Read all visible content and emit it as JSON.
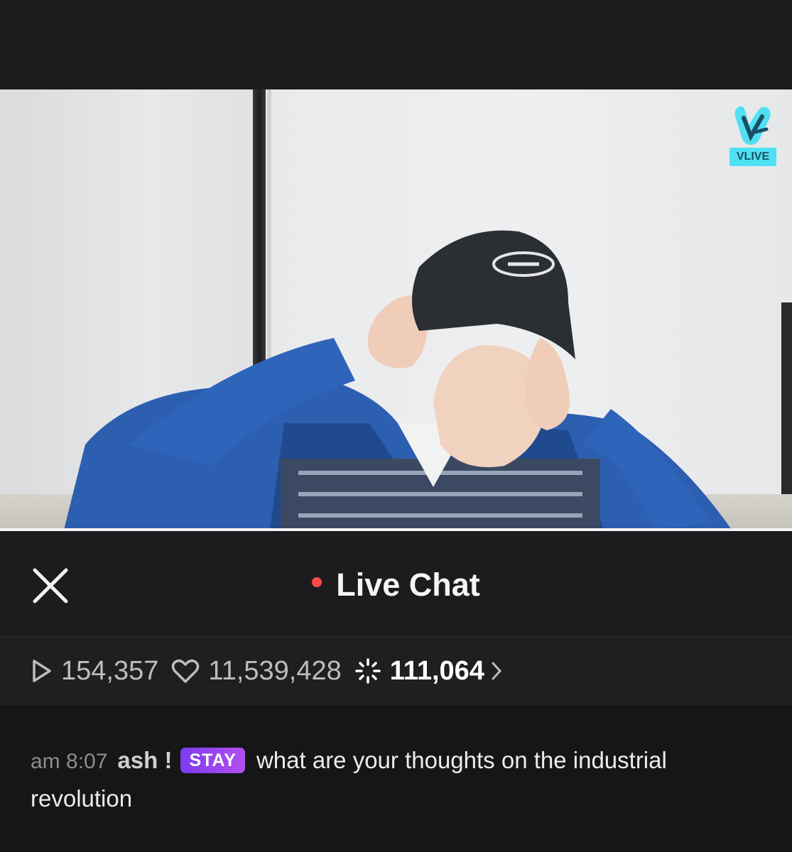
{
  "video": {
    "watermark_label": "VLIVE"
  },
  "header": {
    "close_icon": "close-icon",
    "title": "Live Chat",
    "live_dot_color": "#ff4a4a"
  },
  "stats": {
    "plays": "154,357",
    "hearts": "11,539,428",
    "chemi": "111,064"
  },
  "chat": {
    "messages": [
      {
        "time": "am 8:07",
        "user": "ash !",
        "badge": "STAY",
        "text": "what are your thoughts on the industrial revolution"
      }
    ]
  },
  "colors": {
    "background": "#1c1c1e",
    "badge_gradient_start": "#7b3cf0",
    "badge_gradient_end": "#b14ff0",
    "vlive_accent": "#4fe1f2"
  }
}
